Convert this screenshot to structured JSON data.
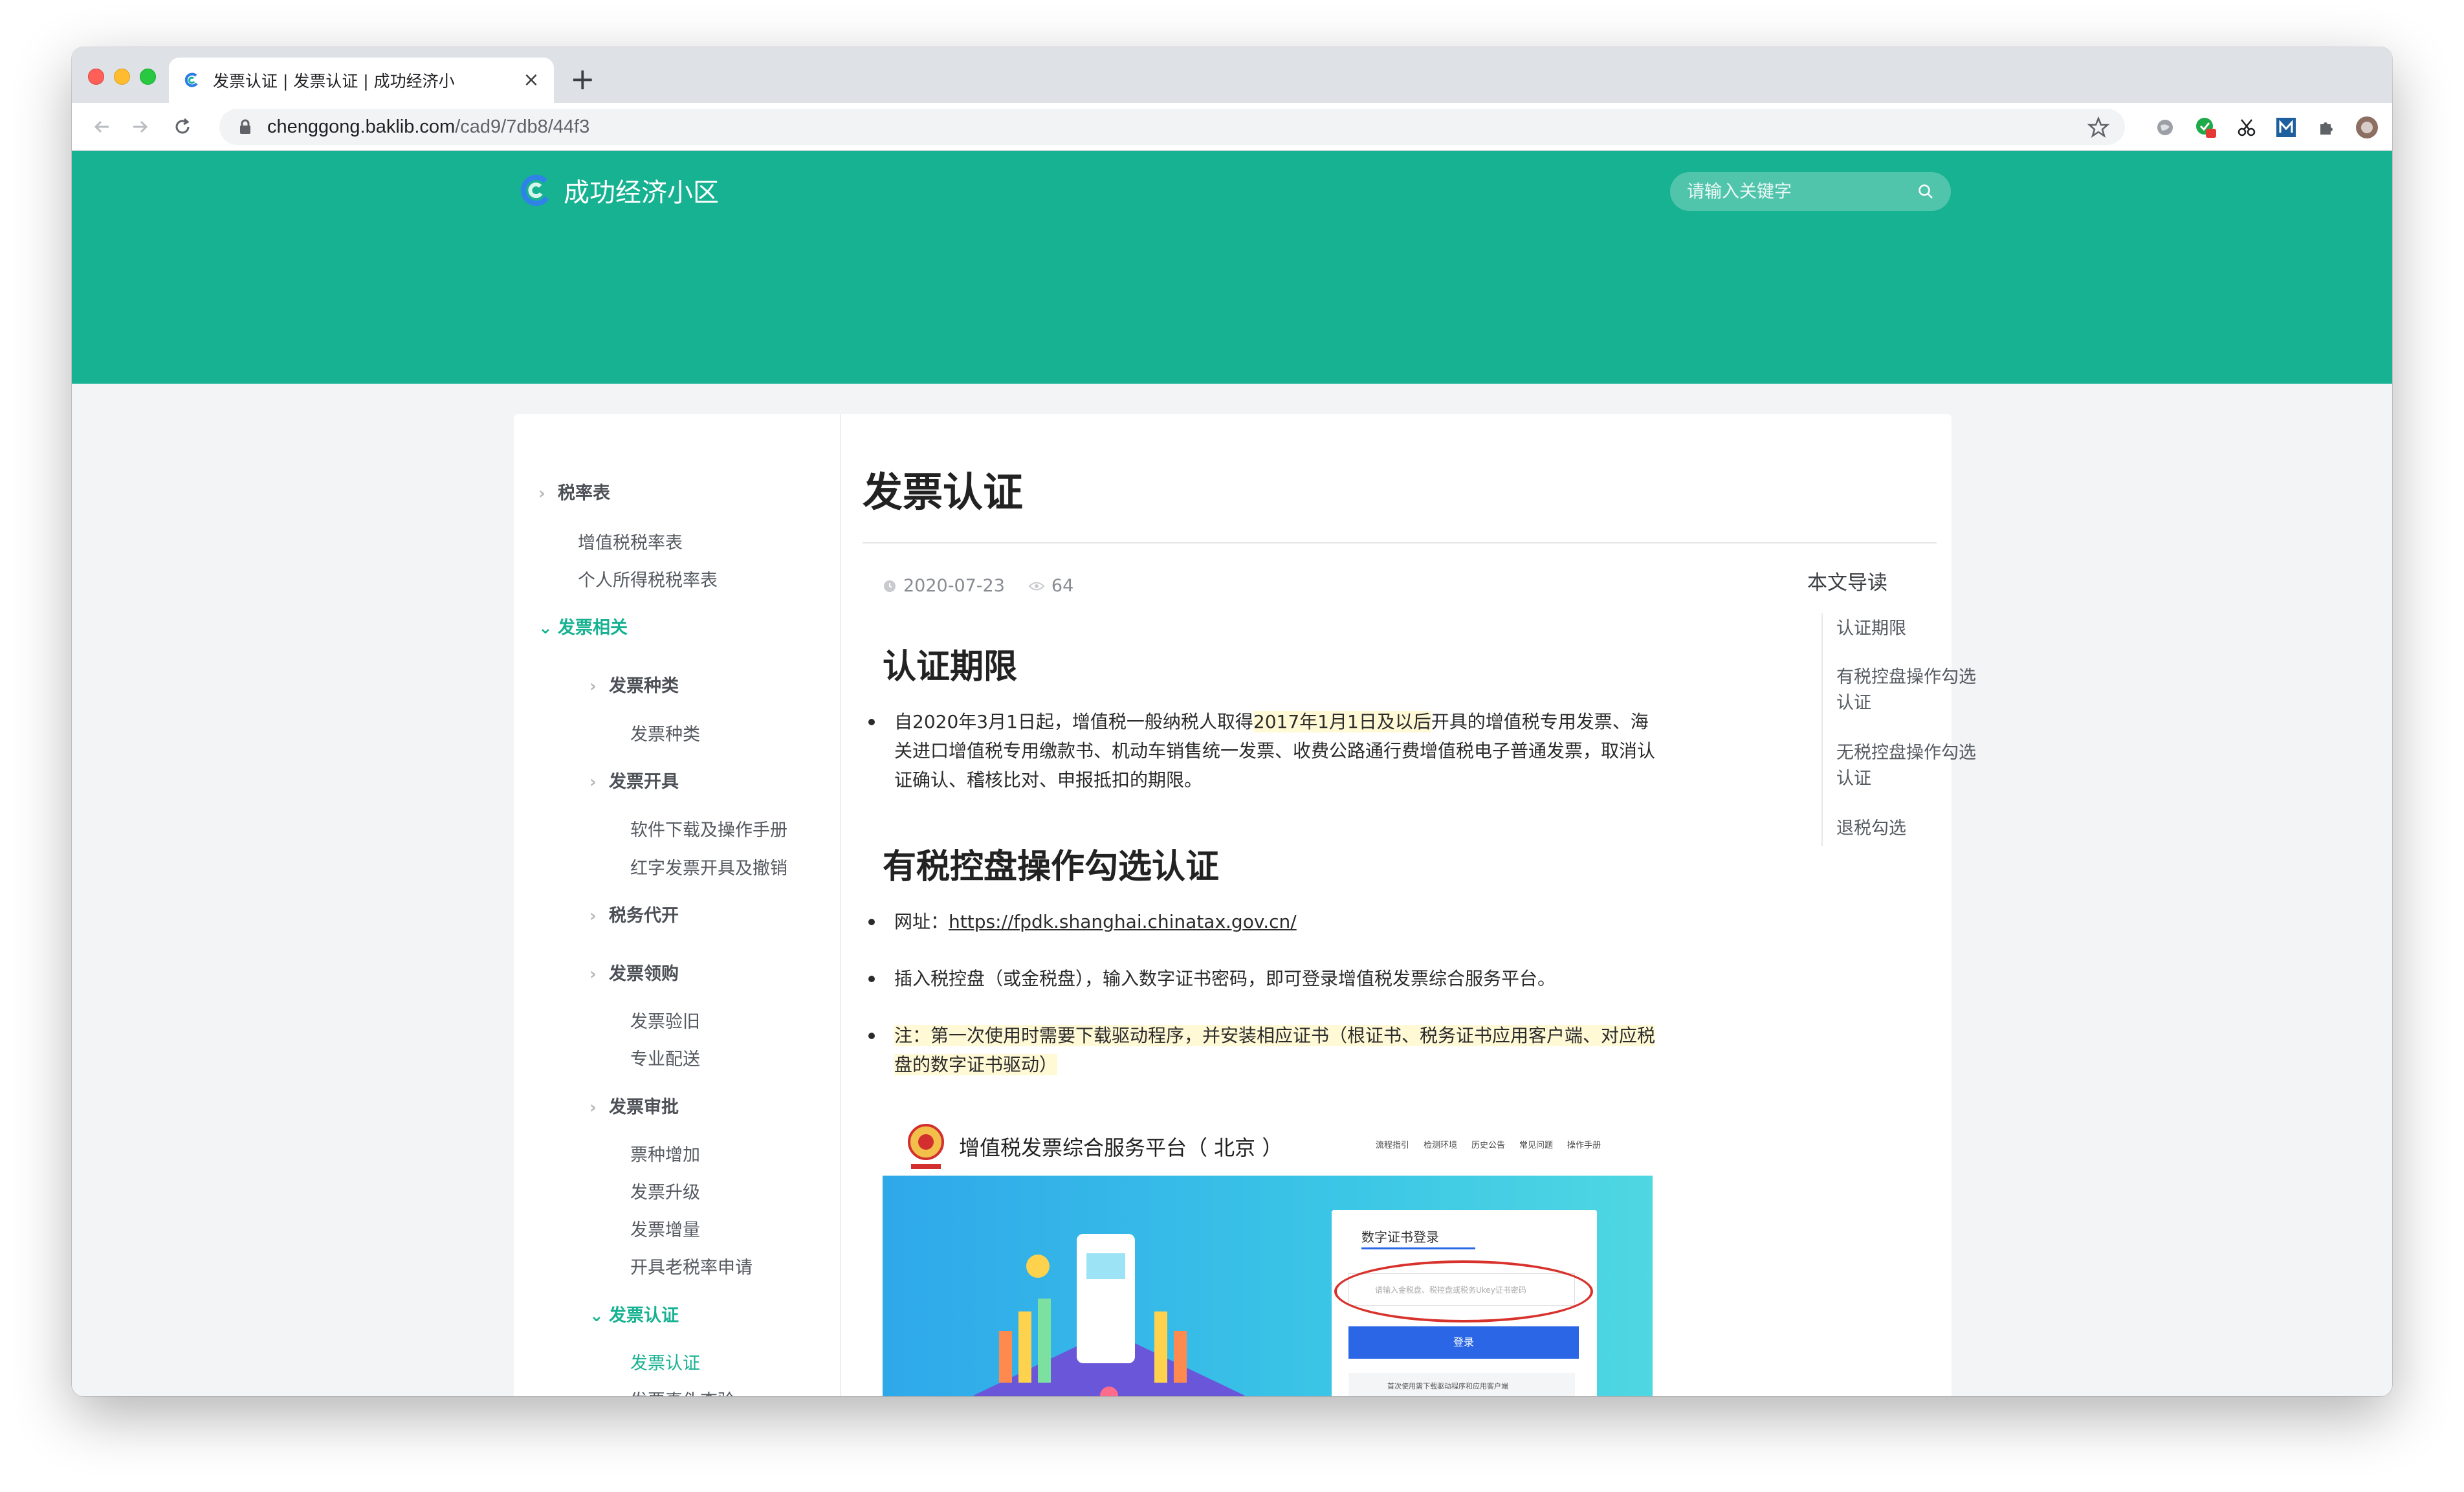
{
  "browser": {
    "tab_title": "发票认证 | 发票认证 | 成功经济小",
    "url_host": "chenggong.baklib.com",
    "url_path": "/cad9/7db8/44f3"
  },
  "site": {
    "name": "成功经济小区",
    "search_placeholder": "请输入关键字"
  },
  "sidebar": {
    "items": [
      {
        "label": "税率表"
      },
      {
        "label": "增值税税率表"
      },
      {
        "label": "个人所得税税率表"
      },
      {
        "label": "发票相关"
      },
      {
        "label": "发票种类"
      },
      {
        "label": "发票种类"
      },
      {
        "label": "发票开具"
      },
      {
        "label": "软件下载及操作手册"
      },
      {
        "label": "红字发票开具及撤销"
      },
      {
        "label": "税务代开"
      },
      {
        "label": "发票领购"
      },
      {
        "label": "发票验旧"
      },
      {
        "label": "专业配送"
      },
      {
        "label": "发票审批"
      },
      {
        "label": "票种增加"
      },
      {
        "label": "发票升级"
      },
      {
        "label": "发票增量"
      },
      {
        "label": "开具老税率申请"
      },
      {
        "label": "发票认证"
      },
      {
        "label": "发票认证"
      },
      {
        "label": "发票真伪查验"
      }
    ]
  },
  "article": {
    "title": "发票认证",
    "date": "2020-07-23",
    "views": "64",
    "section1": {
      "heading": "认证期限",
      "text_a": "自2020年3月1日起，增值税一般纳税人取得",
      "text_hl": "2017年1月1日及以后",
      "text_b": "开具的增值税专用发票、海关进口增值税专用缴款书、机动车销售统一发票、收费公路通行费增值税电子普通发票，取消认证确认、稽核比对、申报抵扣的期限。"
    },
    "section2": {
      "heading": "有税控盘操作勾选认证",
      "url_label": "网址：",
      "url": "https://fpdk.shanghai.chinatax.gov.cn/",
      "step": "插入税控盘（或金税盘），输入数字证书密码，即可登录增值税发票综合服务平台。",
      "note": "注：第一次使用时需要下载驱动程序，并安装相应证书（根证书、税务证书应用客户端、对应税盘的数字证书驱动）"
    },
    "screenshot": {
      "title": "增值税发票综合服务平台（ 北京 ）",
      "nav": [
        "流程指引",
        "检测环境",
        "历史公告",
        "常见问题",
        "操作手册"
      ],
      "login_title": "数字证书登录",
      "login_placeholder": "请输入金税盘、税控盘或税务Ukey证书密码",
      "login_button": "登录",
      "download_link": "首次使用需下载驱动程序和应用客户端"
    }
  },
  "toc": {
    "title": "本文导读",
    "items": [
      "认证期限",
      "有税控盘操作勾选认证",
      "无税控盘操作勾选认证",
      "退税勾选"
    ]
  },
  "colors": {
    "brand": "#17b291",
    "highlight": "#fff9d6"
  }
}
